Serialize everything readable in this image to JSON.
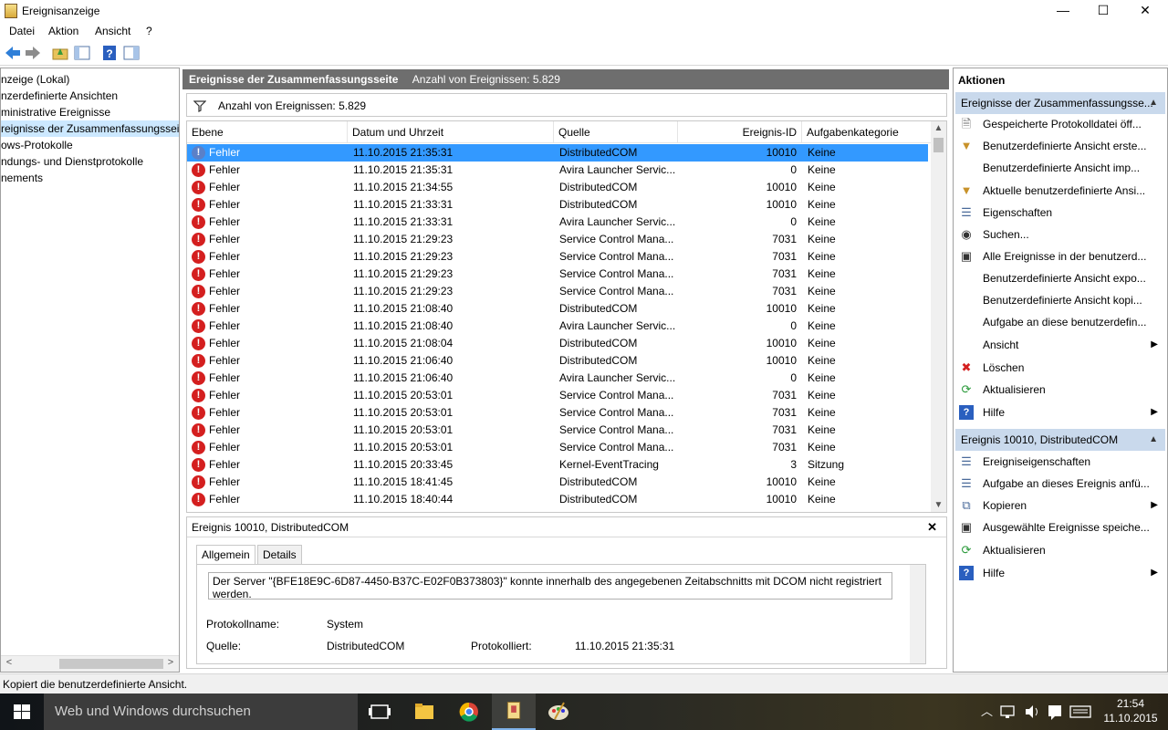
{
  "window": {
    "title": "Ereignisanzeige",
    "min": "—",
    "max": "☐",
    "close": "✕"
  },
  "menu": [
    "Datei",
    "Aktion",
    "Ansicht",
    "?"
  ],
  "tree": [
    "nzeige (Lokal)",
    "nzerdefinierte Ansichten",
    "ministrative Ereignisse",
    "reignisse der Zusammenfassungsseite",
    "ows-Protokolle",
    "ndungs- und Dienstprotokolle",
    "nements"
  ],
  "center": {
    "title": "Ereignisse der Zusammenfassungsseite",
    "count_label": "Anzahl von Ereignissen: 5.829",
    "filter_text": "Anzahl von Ereignissen: 5.829",
    "columns": [
      "Ebene",
      "Datum und Uhrzeit",
      "Quelle",
      "Ereignis-ID",
      "Aufgabenkategorie"
    ],
    "rows": [
      [
        "Fehler",
        "11.10.2015 21:35:31",
        "DistributedCOM",
        "10010",
        "Keine"
      ],
      [
        "Fehler",
        "11.10.2015 21:35:31",
        "Avira Launcher Servic...",
        "0",
        "Keine"
      ],
      [
        "Fehler",
        "11.10.2015 21:34:55",
        "DistributedCOM",
        "10010",
        "Keine"
      ],
      [
        "Fehler",
        "11.10.2015 21:33:31",
        "DistributedCOM",
        "10010",
        "Keine"
      ],
      [
        "Fehler",
        "11.10.2015 21:33:31",
        "Avira Launcher Servic...",
        "0",
        "Keine"
      ],
      [
        "Fehler",
        "11.10.2015 21:29:23",
        "Service Control Mana...",
        "7031",
        "Keine"
      ],
      [
        "Fehler",
        "11.10.2015 21:29:23",
        "Service Control Mana...",
        "7031",
        "Keine"
      ],
      [
        "Fehler",
        "11.10.2015 21:29:23",
        "Service Control Mana...",
        "7031",
        "Keine"
      ],
      [
        "Fehler",
        "11.10.2015 21:29:23",
        "Service Control Mana...",
        "7031",
        "Keine"
      ],
      [
        "Fehler",
        "11.10.2015 21:08:40",
        "DistributedCOM",
        "10010",
        "Keine"
      ],
      [
        "Fehler",
        "11.10.2015 21:08:40",
        "Avira Launcher Servic...",
        "0",
        "Keine"
      ],
      [
        "Fehler",
        "11.10.2015 21:08:04",
        "DistributedCOM",
        "10010",
        "Keine"
      ],
      [
        "Fehler",
        "11.10.2015 21:06:40",
        "DistributedCOM",
        "10010",
        "Keine"
      ],
      [
        "Fehler",
        "11.10.2015 21:06:40",
        "Avira Launcher Servic...",
        "0",
        "Keine"
      ],
      [
        "Fehler",
        "11.10.2015 20:53:01",
        "Service Control Mana...",
        "7031",
        "Keine"
      ],
      [
        "Fehler",
        "11.10.2015 20:53:01",
        "Service Control Mana...",
        "7031",
        "Keine"
      ],
      [
        "Fehler",
        "11.10.2015 20:53:01",
        "Service Control Mana...",
        "7031",
        "Keine"
      ],
      [
        "Fehler",
        "11.10.2015 20:53:01",
        "Service Control Mana...",
        "7031",
        "Keine"
      ],
      [
        "Fehler",
        "11.10.2015 20:33:45",
        "Kernel-EventTracing",
        "3",
        "Sitzung"
      ],
      [
        "Fehler",
        "11.10.2015 18:41:45",
        "DistributedCOM",
        "10010",
        "Keine"
      ],
      [
        "Fehler",
        "11.10.2015 18:40:44",
        "DistributedCOM",
        "10010",
        "Keine"
      ]
    ],
    "selected_row": 0
  },
  "detail": {
    "title": "Ereignis 10010, DistributedCOM",
    "tabs": [
      "Allgemein",
      "Details"
    ],
    "message": "Der Server \"{BFE18E9C-6D87-4450-B37C-E02F0B373803}\" konnte innerhalb des angegebenen Zeitabschnitts mit DCOM nicht registriert werden.",
    "log_name_label": "Protokollname:",
    "log_name": "System",
    "source_label": "Quelle:",
    "source": "DistributedCOM",
    "logged_label": "Protokolliert:",
    "logged": "11.10.2015 21:35:31"
  },
  "actions": {
    "title": "Aktionen",
    "section1": "Ereignisse der Zusammenfassungsse...",
    "items1": [
      {
        "icon": "open-log-icon",
        "label": "Gespeicherte Protokolldatei öff..."
      },
      {
        "icon": "filter-icon",
        "label": "Benutzerdefinierte Ansicht erste..."
      },
      {
        "icon": "",
        "label": "Benutzerdefinierte Ansicht imp..."
      },
      {
        "icon": "filter-icon",
        "label": "Aktuelle benutzerdefinierte Ansi..."
      },
      {
        "icon": "properties-icon",
        "label": "Eigenschaften"
      },
      {
        "icon": "binoculars-icon",
        "label": "Suchen..."
      },
      {
        "icon": "save-icon",
        "label": "Alle Ereignisse in der benutzerd..."
      },
      {
        "icon": "",
        "label": "Benutzerdefinierte Ansicht expo..."
      },
      {
        "icon": "",
        "label": "Benutzerdefinierte Ansicht kopi..."
      },
      {
        "icon": "",
        "label": "Aufgabe an diese benutzerdefin..."
      },
      {
        "icon": "",
        "label": "Ansicht",
        "submenu": true
      },
      {
        "icon": "delete-icon",
        "label": "Löschen"
      },
      {
        "icon": "refresh-icon",
        "label": "Aktualisieren"
      },
      {
        "icon": "help-icon",
        "label": "Hilfe",
        "submenu": true
      }
    ],
    "section2": "Ereignis 10010, DistributedCOM",
    "items2": [
      {
        "icon": "properties-icon",
        "label": "Ereigniseigenschaften"
      },
      {
        "icon": "task-icon",
        "label": "Aufgabe an dieses Ereignis anfü..."
      },
      {
        "icon": "copy-icon",
        "label": "Kopieren",
        "submenu": true
      },
      {
        "icon": "save-icon",
        "label": "Ausgewählte Ereignisse speiche..."
      },
      {
        "icon": "refresh-icon",
        "label": "Aktualisieren"
      },
      {
        "icon": "help-icon",
        "label": "Hilfe",
        "submenu": true
      }
    ]
  },
  "status": "Kopiert die benutzerdefinierte Ansicht.",
  "taskbar": {
    "search_placeholder": "Web und Windows durchsuchen",
    "time": "21:54",
    "date": "11.10.2015"
  },
  "colors": {
    "selection": "#3399ff",
    "section_header": "#c9d9ec",
    "error": "#d41f1f"
  }
}
